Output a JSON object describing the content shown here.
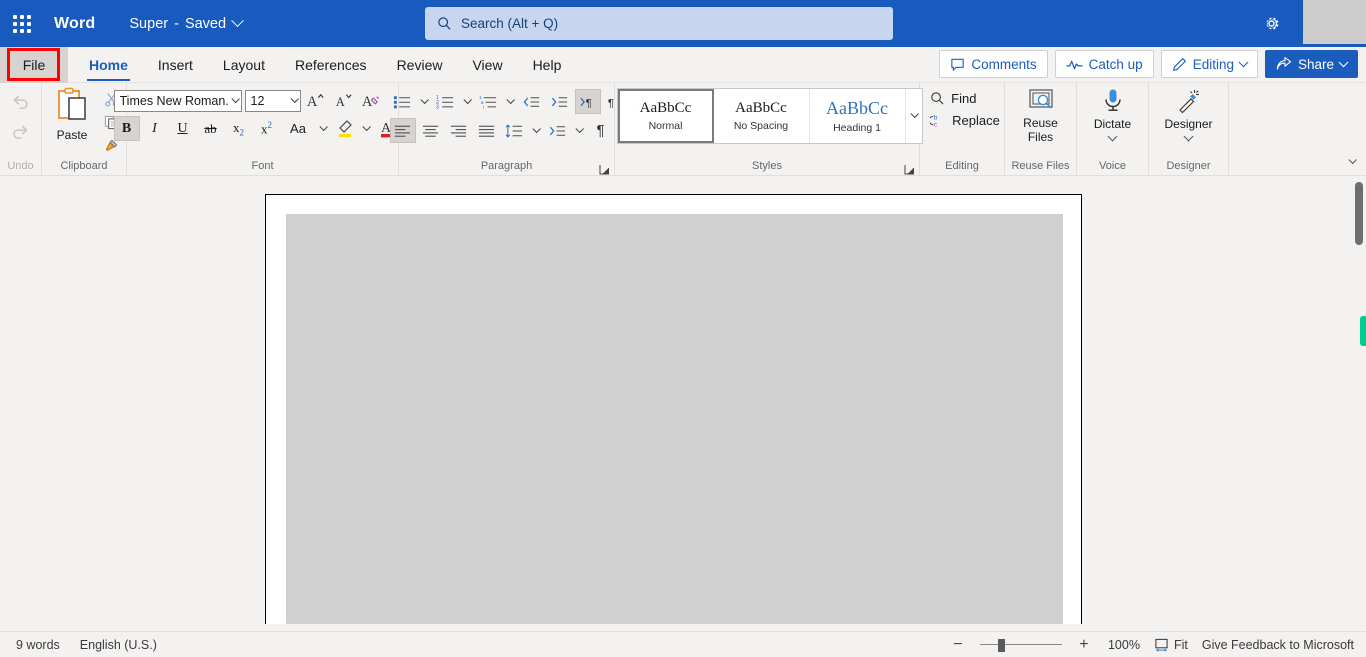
{
  "titlebar": {
    "waffle_label": "app-launcher",
    "app_name": "Word",
    "doc_name": "Super",
    "separator": "-",
    "saved_state": "Saved",
    "search_placeholder": "Search (Alt + Q)",
    "settings_label": "settings"
  },
  "tabs": {
    "file_label": "File",
    "items": [
      {
        "label": "Home",
        "active": true
      },
      {
        "label": "Insert",
        "active": false
      },
      {
        "label": "Layout",
        "active": false
      },
      {
        "label": "References",
        "active": false
      },
      {
        "label": "Review",
        "active": false
      },
      {
        "label": "View",
        "active": false
      },
      {
        "label": "Help",
        "active": false
      }
    ],
    "commands": {
      "comments": "Comments",
      "catch_up": "Catch up",
      "editing": "Editing",
      "share": "Share"
    }
  },
  "ribbon": {
    "undo": {
      "label": "Undo"
    },
    "clipboard": {
      "label": "Clipboard",
      "paste": "Paste"
    },
    "font": {
      "label": "Font",
      "font_name": "Times New Roman...",
      "font_size": "12",
      "bold": "B",
      "italic": "I",
      "underline": "U",
      "strikethrough": "ab",
      "subscript": "x",
      "superscript": "x",
      "change_case": "Aa"
    },
    "paragraph": {
      "label": "Paragraph"
    },
    "styles": {
      "label": "Styles",
      "items": [
        {
          "sample": "AaBbCc",
          "name": "Normal",
          "selected": true
        },
        {
          "sample": "AaBbCc",
          "name": "No Spacing",
          "selected": false
        },
        {
          "sample": "AaBbCc",
          "name": "Heading 1",
          "selected": false
        }
      ]
    },
    "editing": {
      "label": "Editing",
      "find": "Find",
      "replace": "Replace"
    },
    "reuse_files": {
      "label": "Reuse Files",
      "button": "Reuse\nFiles",
      "line1": "Reuse",
      "line2": "Files"
    },
    "voice": {
      "label": "Voice",
      "button": "Dictate"
    },
    "designer": {
      "label": "Designer",
      "button": "Designer"
    }
  },
  "statusbar": {
    "word_count": "9 words",
    "language": "English (U.S.)",
    "zoom_level": "100%",
    "fit_label": "Fit",
    "feedback": "Give Feedback to Microsoft"
  },
  "colors": {
    "brand_blue": "#185abd",
    "accent_blue": "#1b5dbd",
    "highlight_red": "#ff0000",
    "marker_green": "#00cc92"
  }
}
